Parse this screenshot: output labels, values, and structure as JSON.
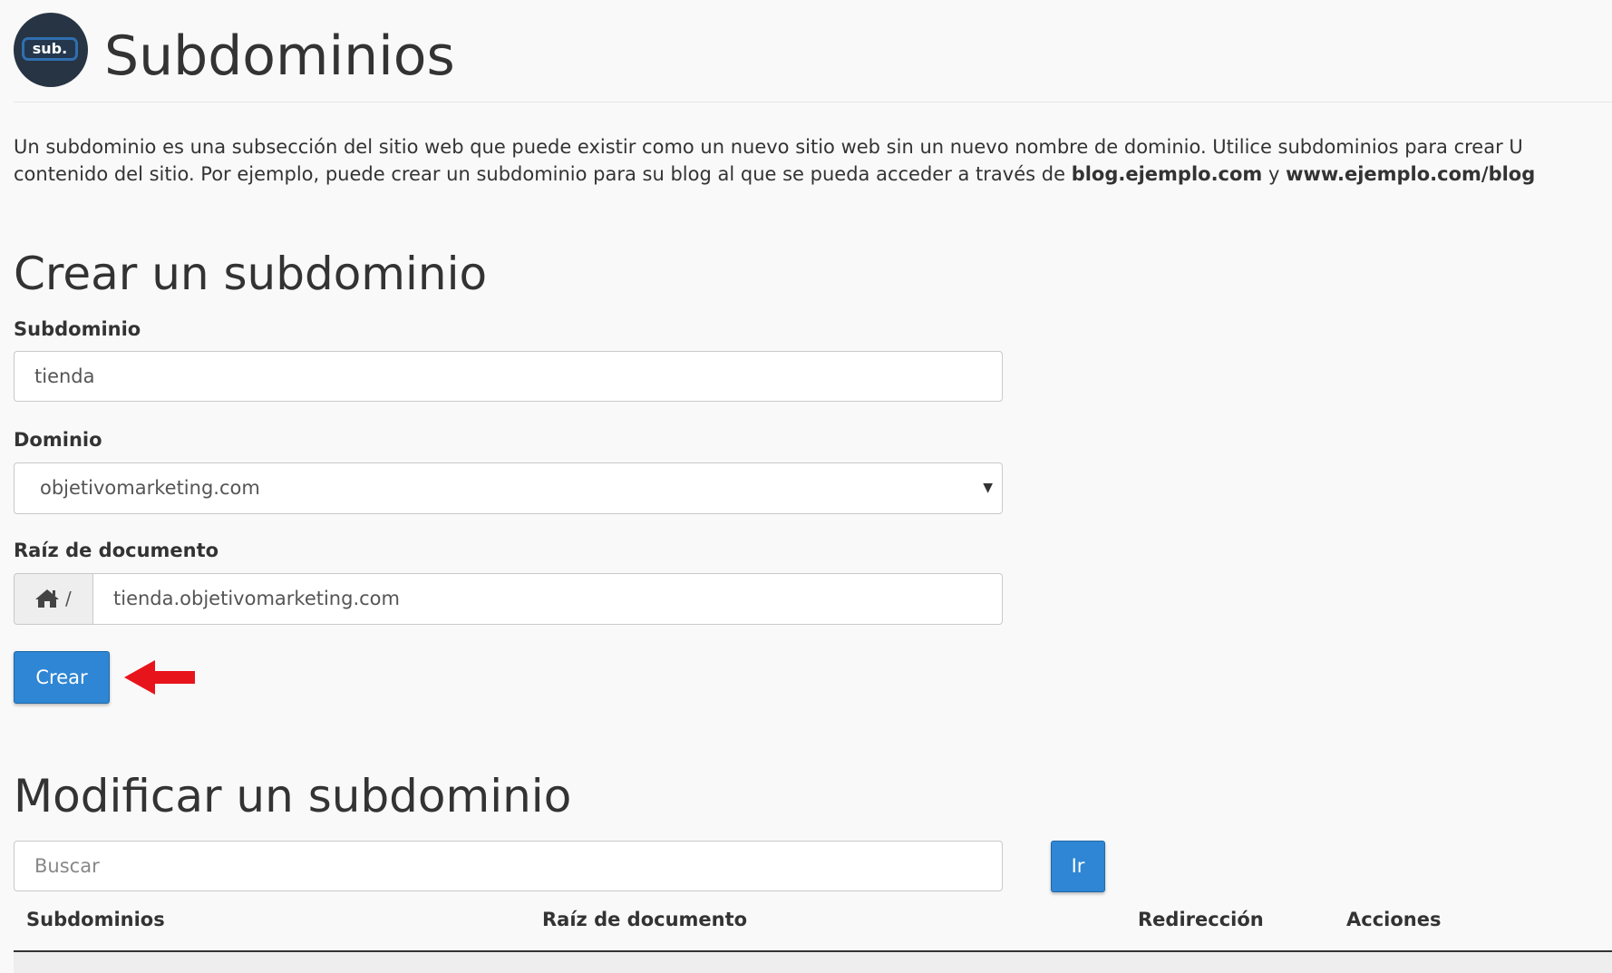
{
  "header": {
    "logo_text": "sub.",
    "title": "Subdominios"
  },
  "description": {
    "line1": "Un subdominio es una subsección del sitio web que puede existir como un nuevo sitio web sin un nuevo nombre de dominio. Utilice subdominios para crear U",
    "line2_prefix": "contenido del sitio. Por ejemplo, puede crear un subdominio para su blog al que se pueda acceder a través de ",
    "example1": "blog.ejemplo.com",
    "connector": " y ",
    "example2": "www.ejemplo.com/blog"
  },
  "create": {
    "title": "Crear un subdominio",
    "subdomain_label": "Subdominio",
    "subdomain_value": "tienda",
    "domain_label": "Dominio",
    "domain_selected": "objetivomarketing.com",
    "docroot_label": "Raíz de documento",
    "docroot_prefix": "/",
    "docroot_value": "tienda.objetivomarketing.com",
    "submit_label": "Crear"
  },
  "modify": {
    "title": "Modificar un subdominio",
    "search_placeholder": "Buscar",
    "go_label": "Ir",
    "columns": [
      "Subdominios",
      "Raíz de documento",
      "Redirección",
      "Acciones"
    ]
  },
  "icons": {
    "logo": "sub-logo-icon",
    "home": "home-icon",
    "caret": "caret-down-icon",
    "arrow": "red-arrow-left-icon"
  },
  "colors": {
    "primary_button": "#2e86d4",
    "arrow": "#e8141b",
    "logo_bg": "#273444"
  }
}
